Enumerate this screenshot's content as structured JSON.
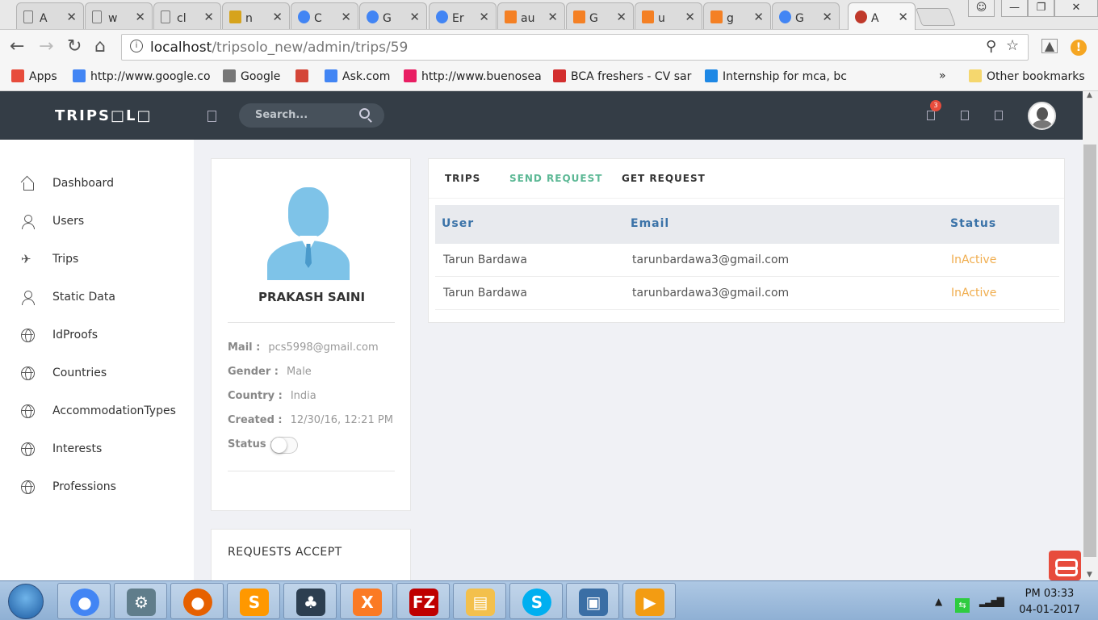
{
  "browser": {
    "tabs": [
      {
        "icon": "doc",
        "title": "A",
        "color": "#777"
      },
      {
        "icon": "doc",
        "title": "w",
        "color": "#777"
      },
      {
        "icon": "doc",
        "title": "cl",
        "color": "#777"
      },
      {
        "icon": "pma",
        "title": "n",
        "color": "#d6a31c"
      },
      {
        "icon": "chrome",
        "title": "C",
        "color": "#4285f4"
      },
      {
        "icon": "google",
        "title": "G",
        "color": "#4285f4"
      },
      {
        "icon": "google",
        "title": "Er",
        "color": "#4285f4"
      },
      {
        "icon": "stack",
        "title": "au",
        "color": "#f48024"
      },
      {
        "icon": "stack",
        "title": "G",
        "color": "#f48024"
      },
      {
        "icon": "stack",
        "title": "u",
        "color": "#f48024"
      },
      {
        "icon": "question",
        "title": "g",
        "color": "#f48024"
      },
      {
        "icon": "google",
        "title": "G",
        "color": "#4285f4"
      },
      {
        "icon": "app",
        "title": "A",
        "color": "#c0392b"
      }
    ],
    "url_host": "localhost",
    "url_path": "/tripsolo_new/admin/trips/59",
    "bookmarks": [
      {
        "label": "Apps",
        "color": "#e74c3c"
      },
      {
        "label": "http://www.google.co",
        "color": "#4285f4"
      },
      {
        "label": "Google",
        "color": "#777"
      },
      {
        "label": "",
        "color": "#d44638"
      },
      {
        "label": "Ask.com",
        "color": "#4285f4"
      },
      {
        "label": "http://www.buenosea",
        "color": "#e91e63"
      },
      {
        "label": "BCA freshers - CV sar",
        "color": "#d32f2f"
      },
      {
        "label": "Internship for mca, bc",
        "color": "#1e88e5"
      }
    ],
    "bookmarks_more": "»",
    "other_bookmarks": "Other bookmarks"
  },
  "app": {
    "logo": "TRIPS□L□",
    "search_placeholder": "Search...",
    "notification_count": "3"
  },
  "sidebar": {
    "items": [
      {
        "label": "Dashboard",
        "icon": "home-icon"
      },
      {
        "label": "Users",
        "icon": "user-icon"
      },
      {
        "label": "Trips",
        "icon": "plane-icon"
      },
      {
        "label": "Static Data",
        "icon": "user-icon"
      },
      {
        "label": "IdProofs",
        "icon": "globe-icon"
      },
      {
        "label": "Countries",
        "icon": "globe-icon"
      },
      {
        "label": "AccommodationTypes",
        "icon": "globe-icon"
      },
      {
        "label": "Interests",
        "icon": "globe-icon"
      },
      {
        "label": "Professions",
        "icon": "globe-icon"
      }
    ]
  },
  "profile": {
    "name": "PRAKASH SAINI",
    "mail_label": "Mail :",
    "mail": "pcs5998@gmail.com",
    "gender_label": "Gender :",
    "gender": "Male",
    "country_label": "Country :",
    "country": "India",
    "created_label": "Created :",
    "created": "12/30/16, 12:21 PM",
    "status_label": "Status :",
    "status_on": false
  },
  "requests_accept": {
    "title": "REQUESTS ACCEPT"
  },
  "main": {
    "tabs": [
      {
        "label": "TRIPS",
        "active": false
      },
      {
        "label": "SEND REQUEST",
        "active": true
      },
      {
        "label": "GET REQUEST",
        "active": false
      }
    ],
    "columns": [
      "User",
      "Email",
      "Status"
    ],
    "rows": [
      {
        "user": "Tarun Bardawa",
        "email": "tarunbardawa3@gmail.com",
        "status": "InActive"
      },
      {
        "user": "Tarun Bardawa",
        "email": "tarunbardawa3@gmail.com",
        "status": "InActive"
      }
    ]
  },
  "taskbar": {
    "apps": [
      {
        "name": "chrome",
        "color": "#4285f4",
        "glyph": "●"
      },
      {
        "name": "system",
        "color": "#607d8b",
        "glyph": "⚙"
      },
      {
        "name": "firefox",
        "color": "#e66000",
        "glyph": "●"
      },
      {
        "name": "sublime",
        "color": "#ff9800",
        "glyph": "S"
      },
      {
        "name": "tree",
        "color": "#2c3e50",
        "glyph": "♣"
      },
      {
        "name": "xampp",
        "color": "#fb7a24",
        "glyph": "X"
      },
      {
        "name": "filezilla",
        "color": "#bf0000",
        "glyph": "FZ"
      },
      {
        "name": "explorer",
        "color": "#f3c04c",
        "glyph": "▤"
      },
      {
        "name": "skype",
        "color": "#00aff0",
        "glyph": "S"
      },
      {
        "name": "network",
        "color": "#3a6ea5",
        "glyph": "▣"
      },
      {
        "name": "media",
        "color": "#f39c12",
        "glyph": "▶"
      }
    ],
    "time": "PM 03:33",
    "date": "04-01-2017"
  }
}
